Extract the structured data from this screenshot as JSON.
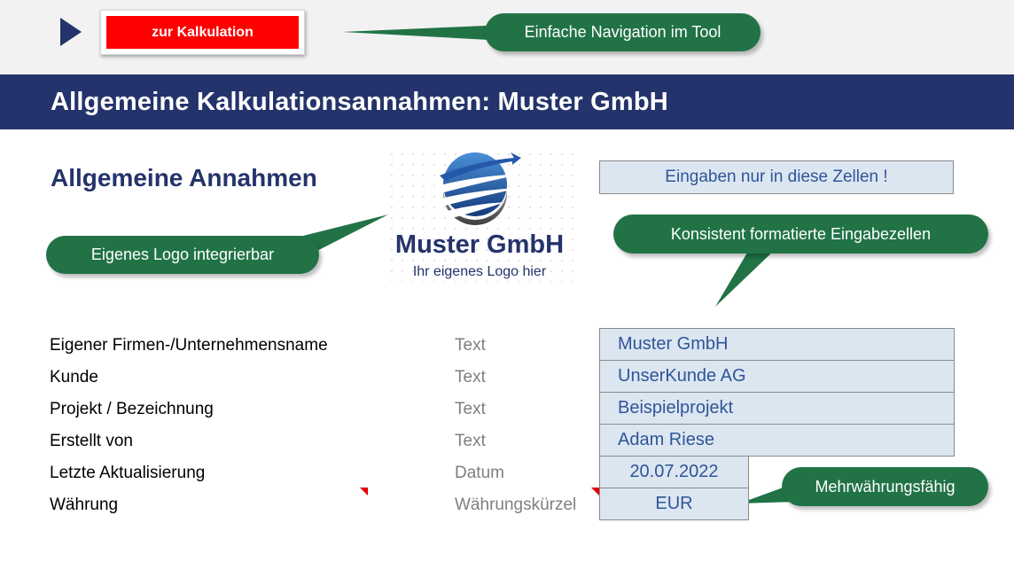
{
  "nav": {
    "button_label": "zur Kalkulation",
    "play_icon": "play-triangle-icon"
  },
  "header": {
    "title": "Allgemeine Kalkulationsannahmen: Muster GmbH"
  },
  "section": {
    "title": "Allgemeine Annahmen",
    "input_hint": "Eingaben nur in diese Zellen !"
  },
  "logo": {
    "name": "Muster GmbH",
    "slogan": "Ihr eigenes Logo hier"
  },
  "callouts": {
    "navigation": "Einfache Navigation im Tool",
    "logo": "Eigenes Logo integrierbar",
    "cells": "Konsistent formatierte Eingabezellen",
    "currency": "Mehrwährungsfähig"
  },
  "rows": [
    {
      "label": "Eigener Firmen-/Unternehmensname",
      "type": "Text",
      "value": "Muster GmbH"
    },
    {
      "label": "Kunde",
      "type": "Text",
      "value": "UnserKunde AG"
    },
    {
      "label": "Projekt / Bezeichnung",
      "type": "Text",
      "value": "Beispielprojekt"
    },
    {
      "label": "Erstellt von",
      "type": "Text",
      "value": "Adam Riese"
    },
    {
      "label": "Letzte Aktualisierung",
      "type": "Datum",
      "value": "20.07.2022"
    },
    {
      "label": "Währung",
      "type": "Währungskürzel",
      "value": "EUR"
    }
  ],
  "colors": {
    "navy": "#24336b",
    "button_red": "#ff0000",
    "callout_green": "#217346",
    "input_fill": "#dce6f1",
    "input_text": "#2f5597"
  }
}
